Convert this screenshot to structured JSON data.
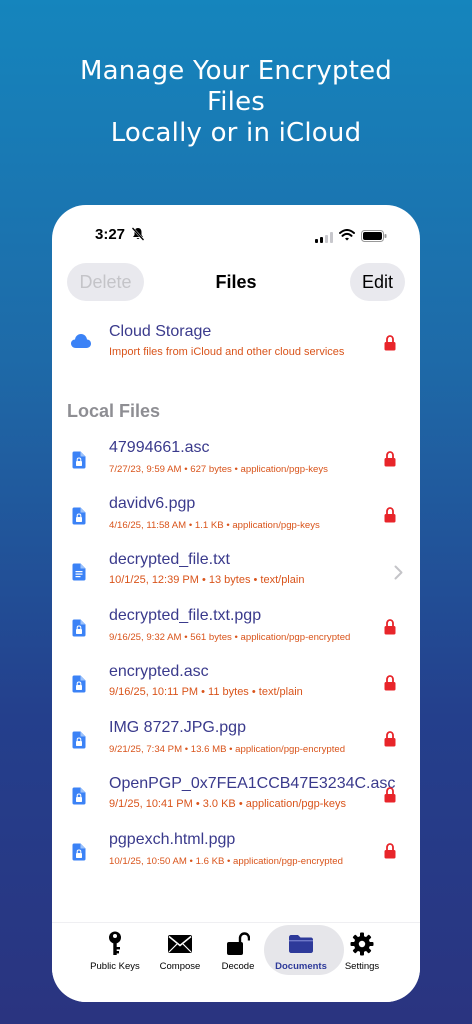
{
  "promo": {
    "line1": "Manage Your Encrypted",
    "line2": "Files",
    "line3": "Locally or in iCloud"
  },
  "status_bar": {
    "time": "3:27"
  },
  "nav": {
    "delete_label": "Delete",
    "title": "Files",
    "edit_label": "Edit"
  },
  "cloud": {
    "title": "Cloud Storage",
    "subtitle": "Import files from iCloud and other cloud services"
  },
  "local_section": {
    "header": "Local Files"
  },
  "files": [
    {
      "name": "47994661.asc",
      "meta": "7/27/23, 9:59 AM • 627 bytes • application/pgp-keys",
      "status": "locked"
    },
    {
      "name": "davidv6.pgp",
      "meta": "4/16/25, 11:58 AM • 1.1 KB • application/pgp-keys",
      "status": "locked"
    },
    {
      "name": "decrypted_file.txt",
      "meta": "10/1/25, 12:39 PM • 13 bytes • text/plain",
      "status": "open"
    },
    {
      "name": "decrypted_file.txt.pgp",
      "meta": "9/16/25, 9:32 AM • 561 bytes • application/pgp-encrypted",
      "status": "locked"
    },
    {
      "name": "encrypted.asc",
      "meta": "9/16/25, 10:11 PM • 11 bytes • text/plain",
      "status": "locked"
    },
    {
      "name": "IMG 8727.JPG.pgp",
      "meta": "9/21/25, 7:34 PM • 13.6 MB • application/pgp-encrypted",
      "status": "locked"
    },
    {
      "name": "OpenPGP_0x7FEA1CCB47E3234C.asc",
      "meta": "9/1/25, 10:41 PM • 3.0 KB • application/pgp-keys",
      "status": "locked"
    },
    {
      "name": "pgpexch.html.pgp",
      "meta": "10/1/25, 10:50 AM • 1.6 KB • application/pgp-encrypted",
      "status": "locked"
    }
  ],
  "tabs": [
    {
      "label": "Public Keys",
      "icon": "key-icon"
    },
    {
      "label": "Compose",
      "icon": "envelope-icon"
    },
    {
      "label": "Decode",
      "icon": "unlock-icon"
    },
    {
      "label": "Documents",
      "icon": "folder-icon",
      "active": true
    },
    {
      "label": "Settings",
      "icon": "gear-icon"
    }
  ],
  "colors": {
    "accent": "#3a3a8c",
    "meta_orange": "#d9541b",
    "lock_red": "#e8252a",
    "file_blue": "#3b82f6"
  }
}
